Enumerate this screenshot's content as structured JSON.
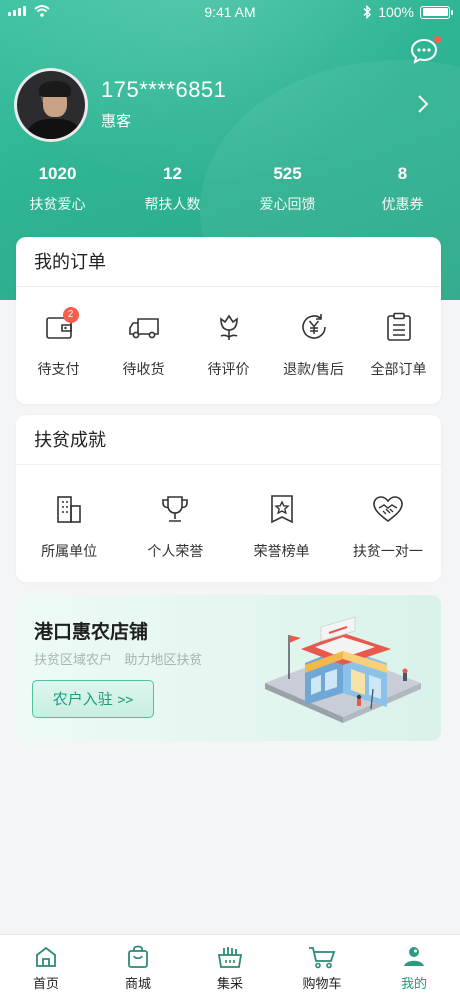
{
  "status_bar": {
    "time": "9:41 AM",
    "battery": "100%"
  },
  "profile": {
    "phone": "175****6851",
    "role": "惠客"
  },
  "stats": [
    {
      "value": "1020",
      "label": "扶贫爱心"
    },
    {
      "value": "12",
      "label": "帮扶人数"
    },
    {
      "value": "525",
      "label": "爱心回馈"
    },
    {
      "value": "8",
      "label": "优惠券"
    }
  ],
  "orders": {
    "title": "我的订单",
    "items": [
      {
        "label": "待支付",
        "icon": "wallet-icon",
        "badge": "2"
      },
      {
        "label": "待收货",
        "icon": "truck-icon"
      },
      {
        "label": "待评价",
        "icon": "flower-icon"
      },
      {
        "label": "退款/售后",
        "icon": "yen-refund-icon"
      },
      {
        "label": "全部订单",
        "icon": "list-icon"
      }
    ]
  },
  "achievements": {
    "title": "扶贫成就",
    "items": [
      {
        "label": "所属单位",
        "icon": "building-icon"
      },
      {
        "label": "个人荣誉",
        "icon": "trophy-icon"
      },
      {
        "label": "荣誉榜单",
        "icon": "ribbon-star-icon"
      },
      {
        "label": "扶贫一对一",
        "icon": "handshake-heart-icon"
      }
    ]
  },
  "banner": {
    "title": "港口惠农店铺",
    "subtitle": "扶贫区域农户   助力地区扶贫",
    "button": "农户入驻",
    "button_arrow": ">>"
  },
  "tabbar": [
    {
      "label": "首页",
      "icon": "home-icon"
    },
    {
      "label": "商城",
      "icon": "shopping-bag-icon"
    },
    {
      "label": "集采",
      "icon": "basket-icon"
    },
    {
      "label": "购物车",
      "icon": "cart-icon"
    },
    {
      "label": "我的",
      "icon": "profile-icon",
      "active": true
    }
  ],
  "colors": {
    "brand": "#2fb594",
    "badge": "#ff5a4e",
    "active_tab": "#1e9b7b"
  }
}
